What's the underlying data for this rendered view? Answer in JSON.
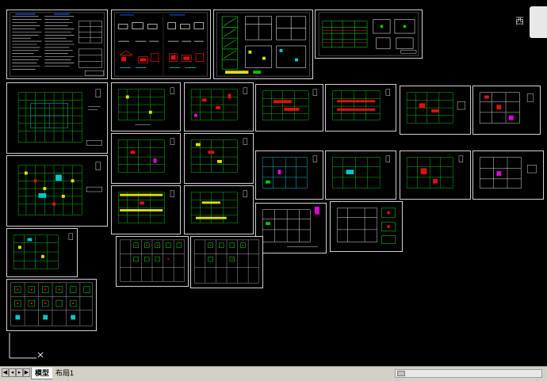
{
  "viewcube": {
    "direction_label": "西"
  },
  "tabs": [
    {
      "label": "模型"
    },
    {
      "label": "布局1"
    }
  ],
  "nav_buttons": [
    "first",
    "previous",
    "next",
    "last"
  ],
  "ucs_icon": "ucs-axis-icon",
  "colors": {
    "background": "#000000",
    "sheet_border": "#cfcfcf",
    "grid_green": "#00c800",
    "dim_cyan": "#00c8c8",
    "rebar_red": "#e01010",
    "text_white": "#ffffff",
    "accent_magenta": "#e000e0",
    "accent_yellow": "#e0e000",
    "accent_blue": "#2050ff"
  }
}
